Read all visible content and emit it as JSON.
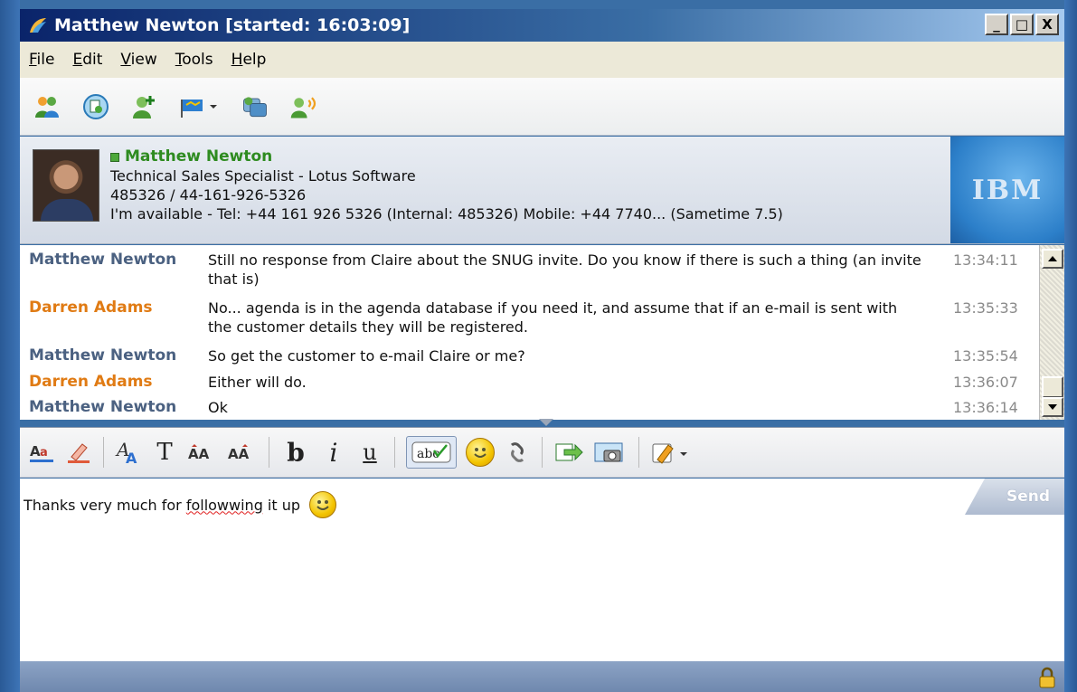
{
  "window": {
    "title": "Matthew Newton [started: 16:03:09]",
    "buttons": [
      "_",
      "□",
      "X"
    ]
  },
  "menu": [
    "File",
    "Edit",
    "View",
    "Tools",
    "Help"
  ],
  "toolbar": {
    "icons": [
      "people-icon",
      "meeting-icon",
      "add-contact-icon",
      "flag-icon",
      "share-icon",
      "call-icon"
    ]
  },
  "card": {
    "name": "Matthew Newton",
    "title": "Technical Sales Specialist - Lotus Software",
    "phone": "485326 / 44-161-926-5326",
    "status": "I'm available - Tel: +44 161 926 5326  (Internal: 485326)  Mobile: +44 7740... (Sametime 7.5)",
    "logo": "IBM"
  },
  "transcript": [
    {
      "who": "Matthew Newton",
      "role": "mn",
      "text": "Still no response from Claire about the SNUG invite. Do you know if there is such a thing (an invite that is)",
      "time": "13:34:11"
    },
    {
      "who": "Darren Adams",
      "role": "da",
      "text": "No... agenda is in the agenda database if you need it, and assume that if an e-mail is sent with the customer details they will be registered.",
      "time": "13:35:33"
    },
    {
      "who": "Matthew Newton",
      "role": "mn",
      "text": "So get the customer to e-mail Claire or me?",
      "time": "13:35:54"
    },
    {
      "who": "Darren Adams",
      "role": "da",
      "text": "Either will do.",
      "time": "13:36:07"
    },
    {
      "who": "Matthew Newton",
      "role": "mn",
      "text": "Ok",
      "time": "13:36:14"
    }
  ],
  "format_toolbar": {
    "bold": "b",
    "italic": "i",
    "underline": "u"
  },
  "input": {
    "before": "Thanks very much for ",
    "misspelled": "followwing",
    "after": " it up"
  },
  "send_label": "Send",
  "colors": {
    "name_mn": "#4b6181",
    "name_da": "#e07b14",
    "card_name": "#2e8b20"
  }
}
